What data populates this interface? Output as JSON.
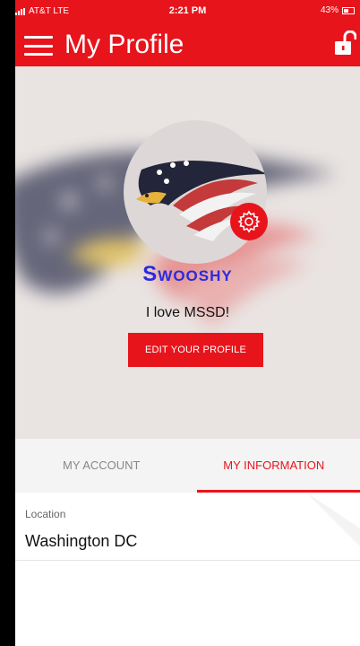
{
  "status_bar": {
    "carrier": "AT&T LTE",
    "time": "2:21 PM",
    "battery": "43%"
  },
  "header": {
    "title": "My Profile",
    "menu_icon": "hamburger-menu-icon",
    "lock_icon": "unlock-icon"
  },
  "profile": {
    "username": "Swooshy",
    "bio": "I love MSSD!",
    "edit_button_label": "EDIT YOUR PROFILE",
    "settings_icon": "gear-icon"
  },
  "tabs": [
    {
      "label": "MY ACCOUNT",
      "active": false
    },
    {
      "label": "MY INFORMATION",
      "active": true
    }
  ],
  "information": {
    "location_label": "Location",
    "location_value": "Washington DC"
  },
  "colors": {
    "primary": "#e8141c",
    "username": "#2a2ae0",
    "hero_bg": "#e9e4e2"
  }
}
